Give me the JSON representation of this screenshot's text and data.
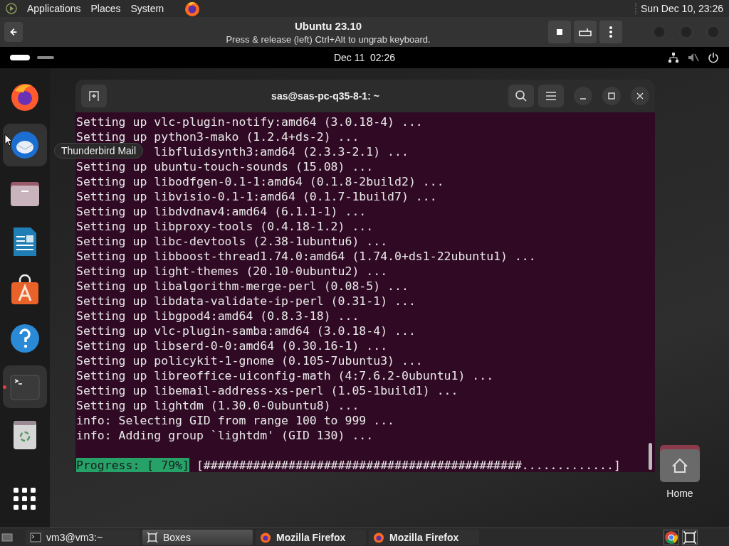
{
  "top_panel": {
    "menus": [
      "Applications",
      "Places",
      "System"
    ],
    "clock": "Sun Dec 10, 23:26"
  },
  "boxes_header": {
    "title": "Ubuntu 23.10",
    "subtitle": "Press & release (left) Ctrl+Alt to ungrab keyboard."
  },
  "guest": {
    "clock": "Dec 11  02:26",
    "dock": [
      {
        "kind": "firefox",
        "selected": false,
        "running": false
      },
      {
        "kind": "thunderbird",
        "selected": true,
        "running": false
      },
      {
        "kind": "files",
        "selected": false,
        "running": false
      },
      {
        "kind": "writer",
        "selected": false,
        "running": false
      },
      {
        "kind": "appcenter",
        "selected": false,
        "running": false
      },
      {
        "kind": "help",
        "selected": false,
        "running": false
      },
      {
        "kind": "terminal",
        "selected": true,
        "running": true
      },
      {
        "kind": "trash",
        "selected": false,
        "running": false
      },
      {
        "kind": "apps",
        "selected": false,
        "running": false
      }
    ],
    "tooltip": "Thunderbird Mail",
    "terminal": {
      "title": "sas@sas-pc-q35-8-1: ~",
      "lines": [
        {
          "kind": "full",
          "text": "Setting up vlc-plugin-notify:amd64 (3.0.18-4) ..."
        },
        {
          "kind": "full",
          "text": "Setting up python3-mako (1.2.4+ds-2) ..."
        },
        {
          "kind": "tail",
          "text": "libfluidsynth3:amd64 (2.3.3-2.1) ..."
        },
        {
          "kind": "full",
          "text": "Setting up ubuntu-touch-sounds (15.08) ..."
        },
        {
          "kind": "full",
          "text": "Setting up libodfgen-0.1-1:amd64 (0.1.8-2build2) ..."
        },
        {
          "kind": "full",
          "text": "Setting up libvisio-0.1-1:amd64 (0.1.7-1build7) ..."
        },
        {
          "kind": "full",
          "text": "Setting up libdvdnav4:amd64 (6.1.1-1) ..."
        },
        {
          "kind": "full",
          "text": "Setting up libproxy-tools (0.4.18-1.2) ..."
        },
        {
          "kind": "full",
          "text": "Setting up libc-devtools (2.38-1ubuntu6) ..."
        },
        {
          "kind": "full",
          "text": "Setting up libboost-thread1.74.0:amd64 (1.74.0+ds1-22ubuntu1) ..."
        },
        {
          "kind": "full",
          "text": "Setting up light-themes (20.10-0ubuntu2) ..."
        },
        {
          "kind": "full",
          "text": "Setting up libalgorithm-merge-perl (0.08-5) ..."
        },
        {
          "kind": "full",
          "text": "Setting up libdata-validate-ip-perl (0.31-1) ..."
        },
        {
          "kind": "full",
          "text": "Setting up libgpod4:amd64 (0.8.3-18) ..."
        },
        {
          "kind": "full",
          "text": "Setting up vlc-plugin-samba:amd64 (3.0.18-4) ..."
        },
        {
          "kind": "full",
          "text": "Setting up libserd-0-0:amd64 (0.30.16-1) ..."
        },
        {
          "kind": "full",
          "text": "Setting up policykit-1-gnome (0.105-7ubuntu3) ..."
        },
        {
          "kind": "full",
          "text": "Setting up libreoffice-uiconfig-math (4:7.6.2-0ubuntu1) ..."
        },
        {
          "kind": "full",
          "text": "Setting up libemail-address-xs-perl (1.05-1build1) ..."
        },
        {
          "kind": "full",
          "text": "Setting up lightdm (1.30.0-0ubuntu8) ..."
        },
        {
          "kind": "full",
          "text": "info: Selecting GID from range 100 to 999 ..."
        },
        {
          "kind": "full",
          "text": "info: Adding group `lightdm' (GID 130) ..."
        }
      ],
      "progress": {
        "label": "Progress: [ 79%]",
        "bar": "[#############################################.............]"
      }
    },
    "desktop_icons": [
      {
        "label": "Home"
      }
    ]
  },
  "taskbar": [
    {
      "kind": "terminal",
      "label": "vm3@vm3:~",
      "selected": false
    },
    {
      "kind": "boxes",
      "label": "Boxes",
      "selected": true
    },
    {
      "kind": "firefox",
      "label": "Mozilla Firefox",
      "selected": false
    },
    {
      "kind": "firefox",
      "label": "Mozilla Firefox",
      "selected": false
    }
  ]
}
